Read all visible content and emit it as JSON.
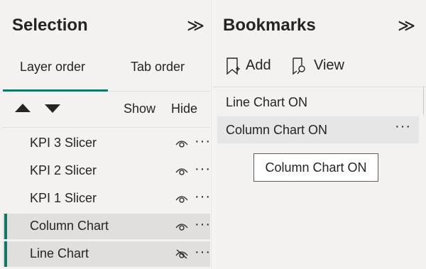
{
  "selection": {
    "title": "Selection",
    "collapse_glyph": "≫",
    "tabs": [
      {
        "label": "Layer order",
        "active": true
      },
      {
        "label": "Tab order",
        "active": false
      }
    ],
    "show_label": "Show",
    "hide_label": "Hide",
    "layers": [
      {
        "label": "KPI 3 Slicer",
        "visible": true,
        "selected": false
      },
      {
        "label": "KPI 2 Slicer",
        "visible": true,
        "selected": false
      },
      {
        "label": "KPI 1 Slicer",
        "visible": true,
        "selected": false
      },
      {
        "label": "Column Chart",
        "visible": true,
        "selected": true
      },
      {
        "label": "Line Chart",
        "visible": false,
        "selected": true
      }
    ],
    "more_glyph": "···"
  },
  "bookmarks": {
    "title": "Bookmarks",
    "collapse_glyph": "≫",
    "add_label": "Add",
    "view_label": "View",
    "items": [
      {
        "label": "Line Chart ON"
      },
      {
        "label": "Column Chart ON"
      }
    ],
    "more_glyph": "···",
    "tooltip": "Column Chart ON"
  },
  "colors": {
    "accent": "#117865",
    "pane_bg": "#f3f2f1",
    "selected_row_bg": "#e1dfdd",
    "text": "#252423"
  }
}
